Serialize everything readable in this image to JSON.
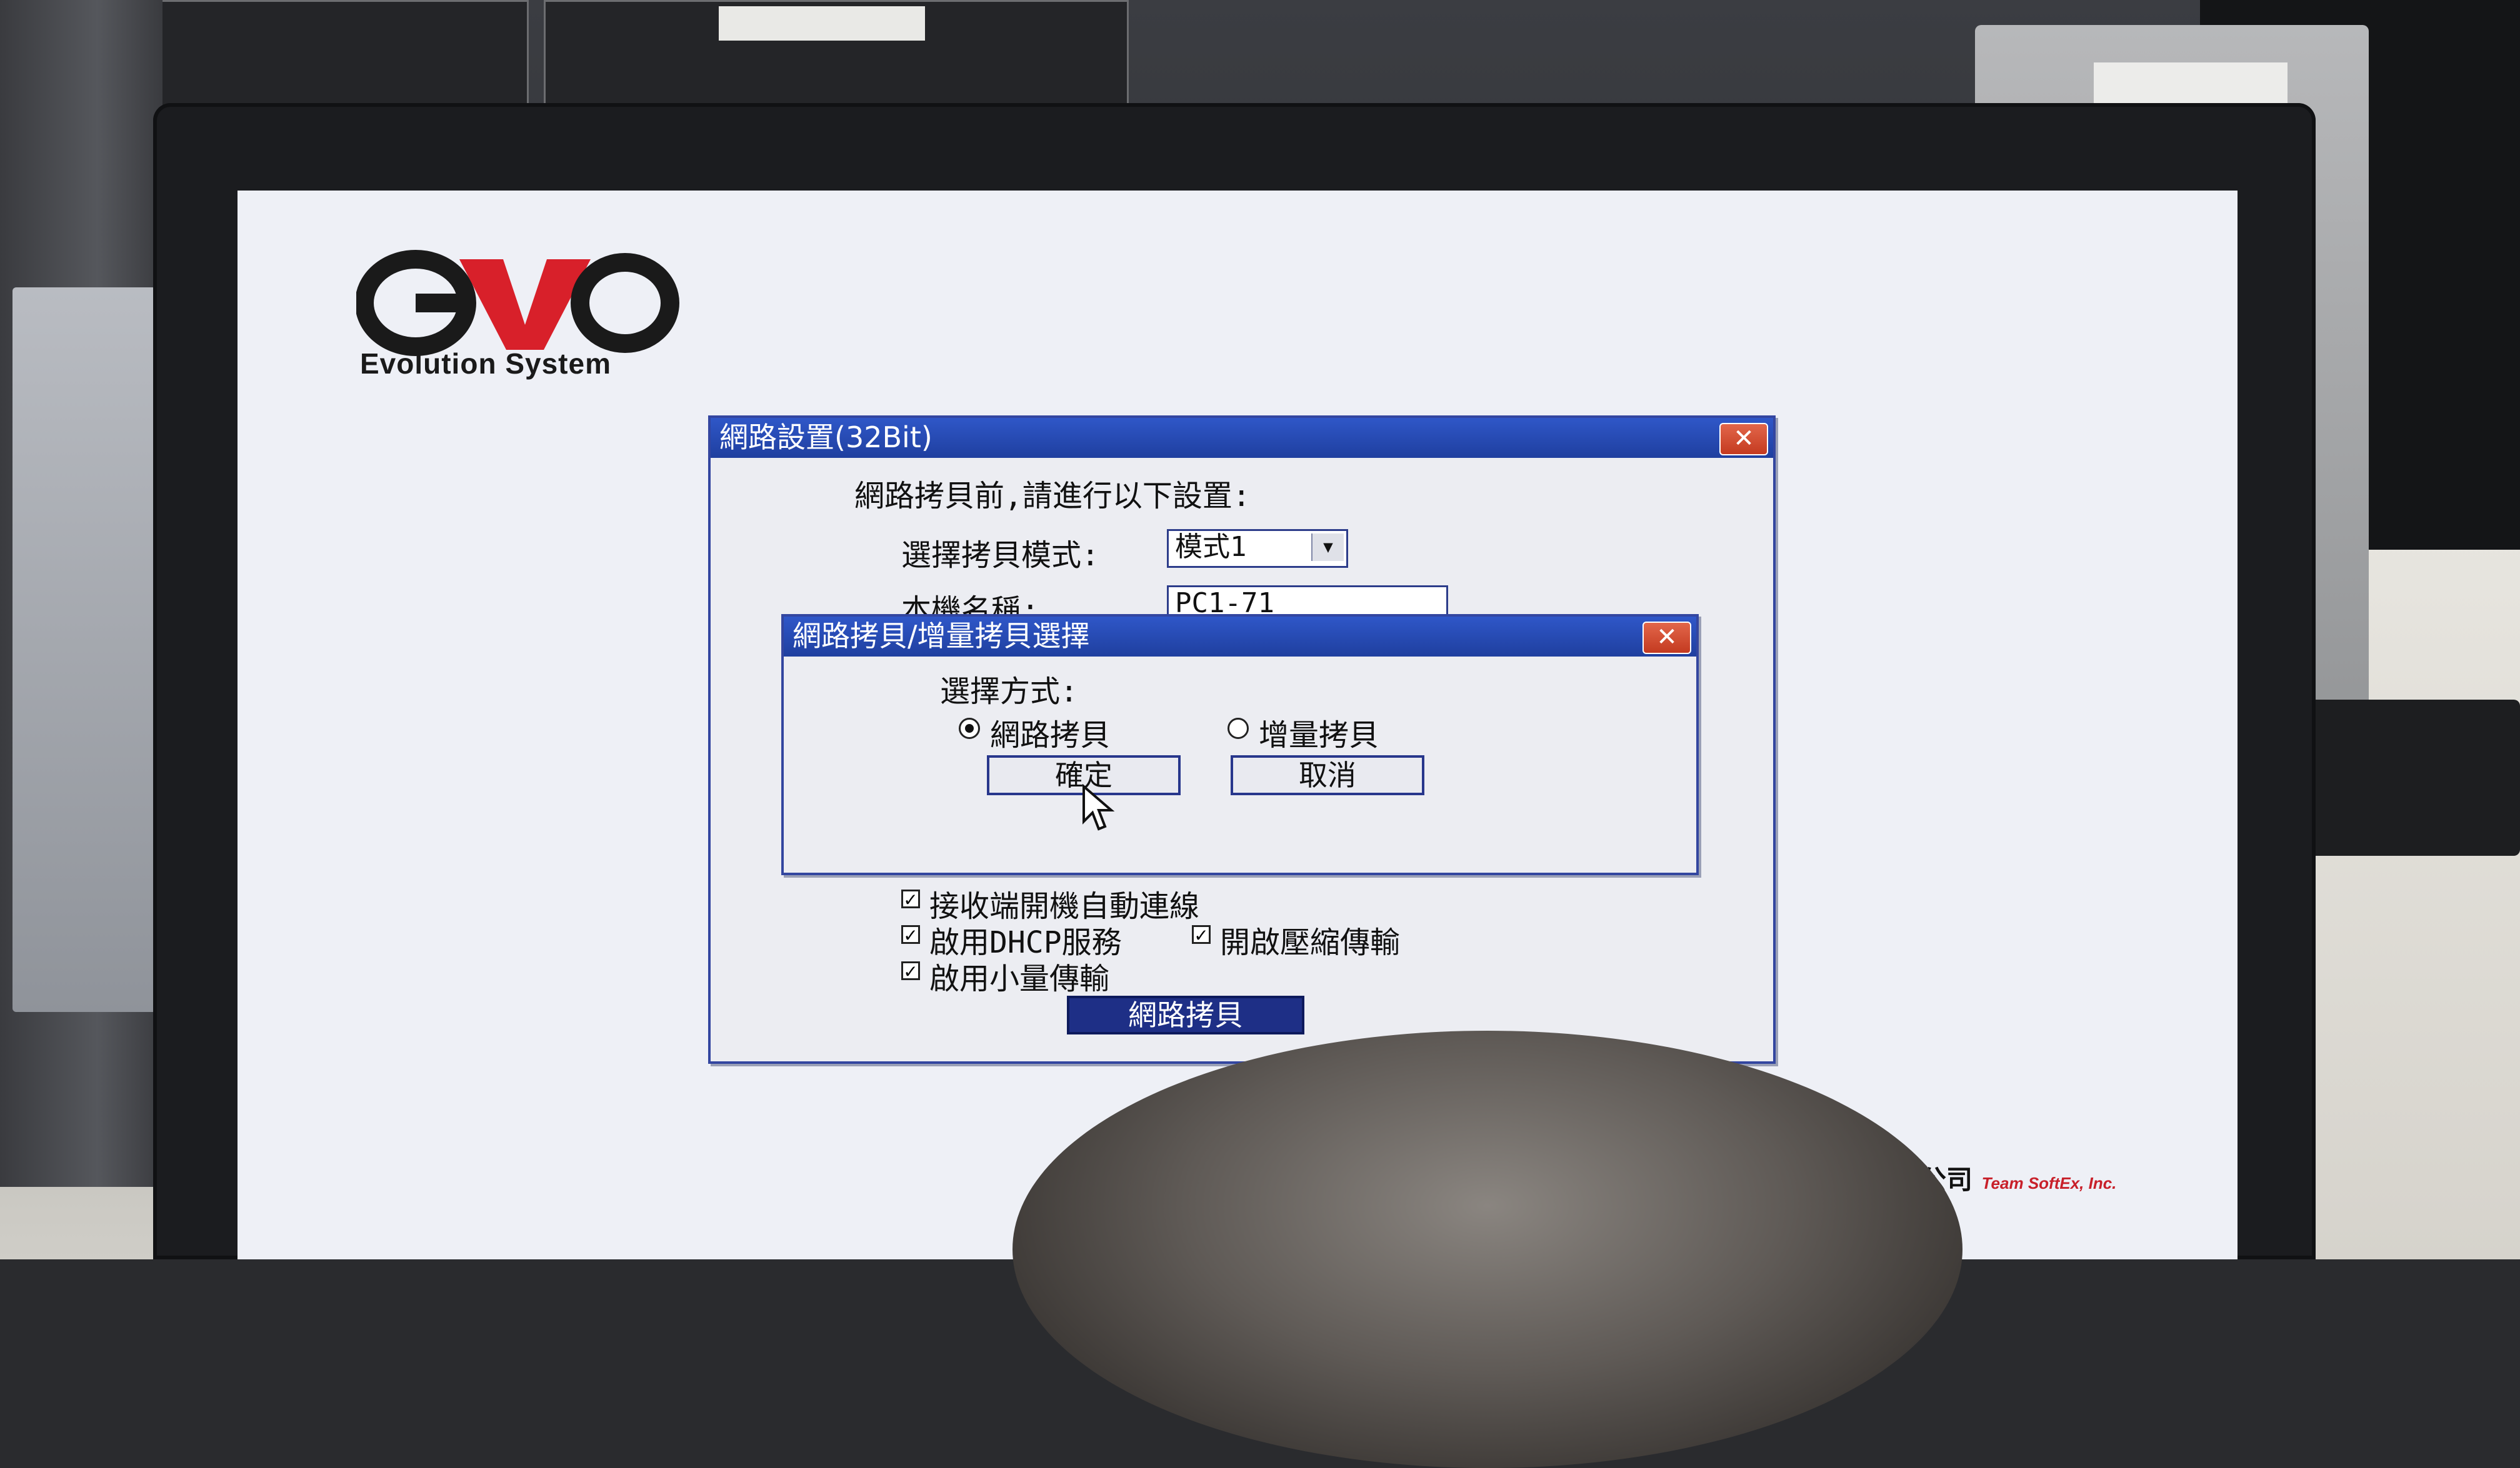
{
  "app": {
    "logo_text": "Evolution System",
    "footer_brand_cn": "科技股份有限公司",
    "footer_brand_en": "Team SoftEx, Inc."
  },
  "network_settings": {
    "title": "網路設置(32Bit)",
    "close_label": "✕",
    "instruction": "網路拷貝前,請進行以下設置:",
    "mode_label": "選擇拷貝模式:",
    "mode_value": "模式1",
    "hostname_label": "本機名稱:",
    "hostname_value": "PC1-71",
    "options": {
      "auto_connect": "接收端開機自動連線",
      "enable_dhcp": "啟用DHCP服務",
      "enable_compression": "開啟壓縮傳輸",
      "small_transfer": "啟用小量傳輸"
    },
    "copy_button": "網路拷貝"
  },
  "copy_type_dialog": {
    "title": "網路拷貝/增量拷貝選擇",
    "close_label": "✕",
    "prompt": "選擇方式:",
    "option_network": "網路拷貝",
    "option_incremental": "增量拷貝",
    "selected": "網路拷貝",
    "ok_label": "確定",
    "cancel_label": "取消"
  },
  "colors": {
    "titlebar": "#1f3f9f",
    "close": "#c43a20",
    "logo_red": "#d8202a",
    "logo_dark": "#1a1a1a"
  }
}
